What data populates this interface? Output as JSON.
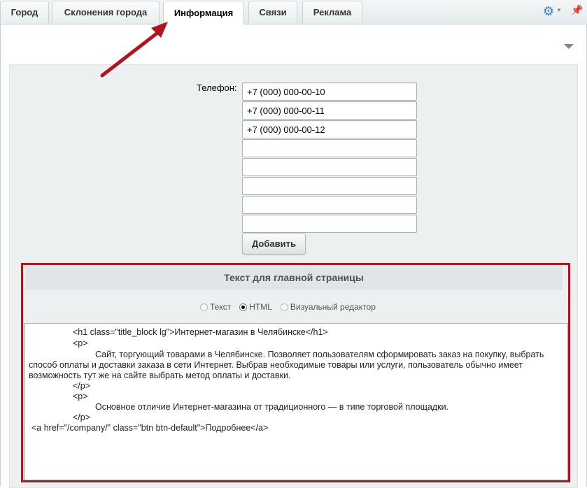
{
  "tabs": [
    {
      "label": "Город",
      "active": false
    },
    {
      "label": "Склонения города",
      "active": false
    },
    {
      "label": "Информация",
      "active": true
    },
    {
      "label": "Связи",
      "active": false
    },
    {
      "label": "Реклама",
      "active": false
    }
  ],
  "toolbar_icons": [
    "gear-icon",
    "caret-down-icon",
    "pin-icon"
  ],
  "phones": {
    "label": "Телефон:",
    "values": [
      "+7 (000) 000-00-10",
      "+7 (000) 000-00-11",
      "+7 (000) 000-00-12",
      "",
      "",
      "",
      "",
      ""
    ],
    "add_button": "Добавить"
  },
  "main_text": {
    "title": "Текст для главной страницы",
    "modes": [
      {
        "label": "Текст",
        "checked": false
      },
      {
        "label": "HTML",
        "checked": true
      },
      {
        "label": "Визуальный редактор",
        "checked": false
      }
    ],
    "code_lines": [
      "<h1 class=\"title_block lg\">Интернет-магазин в Челябинске</h1>",
      "<p>",
      "Сайт, торгующий товарами в Челябинске. Позволяет пользователям сформировать заказ на покупку, выбрать",
      "способ оплаты и доставки заказа в сети Интернет. Выбрав необходимые товары или услуги, пользователь обычно имеет",
      "возможность тут же на сайте выбрать метод оплаты и доставки.",
      "</p>",
      "<p>",
      "Основное отличие Интернет-магазина от традиционного — в типе торговой площадки.",
      "</p>",
      "<a href=\"/company/\" class=\"btn btn-default\">Подробнее</a>"
    ]
  },
  "colors": {
    "highlight": "#b3121f",
    "arrow": "#b3121f",
    "panel_bg": "#ecf0f1",
    "accent": "#2d7fc3"
  }
}
